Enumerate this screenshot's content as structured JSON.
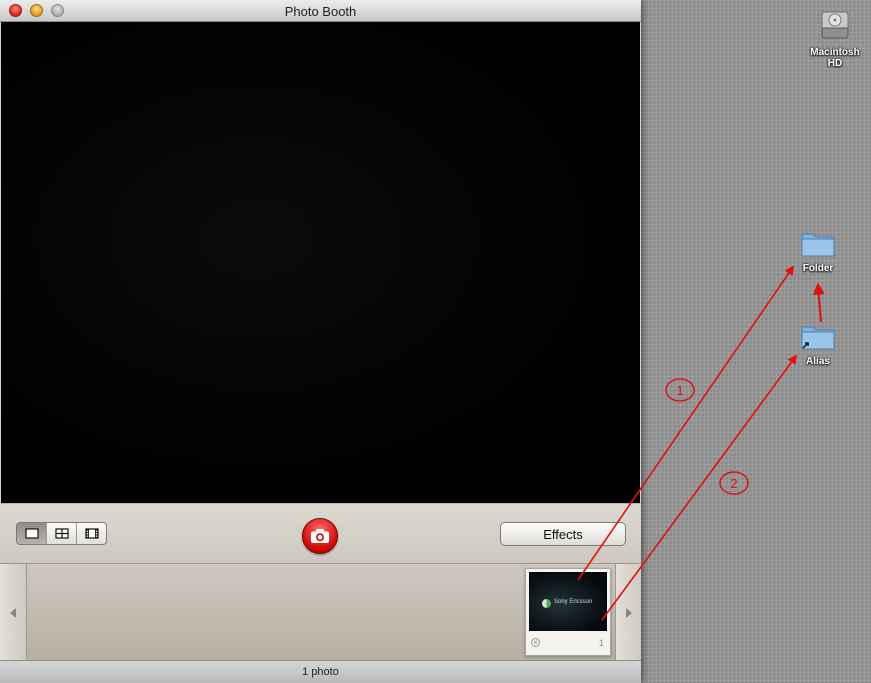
{
  "window": {
    "title": "Photo Booth",
    "controls": {
      "modes": [
        "single-photo",
        "four-photos",
        "movie-clip"
      ],
      "active_mode": "single-photo",
      "shutter_icon": "camera-icon",
      "effects_label": "Effects"
    },
    "strip": {
      "thumbnail": {
        "brand_text": "Sony Ericsson",
        "number": "1"
      }
    },
    "status": "1 photo"
  },
  "desktop": {
    "icons": [
      {
        "label_line1": "Macintosh",
        "label_line2": "HD",
        "icon": "hard-drive-icon"
      },
      {
        "label": "Folder",
        "icon": "folder-icon"
      },
      {
        "label": "Alias",
        "icon": "folder-alias-icon"
      }
    ]
  },
  "annotations": {
    "steps": [
      "1",
      "2"
    ],
    "color": "#e01010"
  }
}
